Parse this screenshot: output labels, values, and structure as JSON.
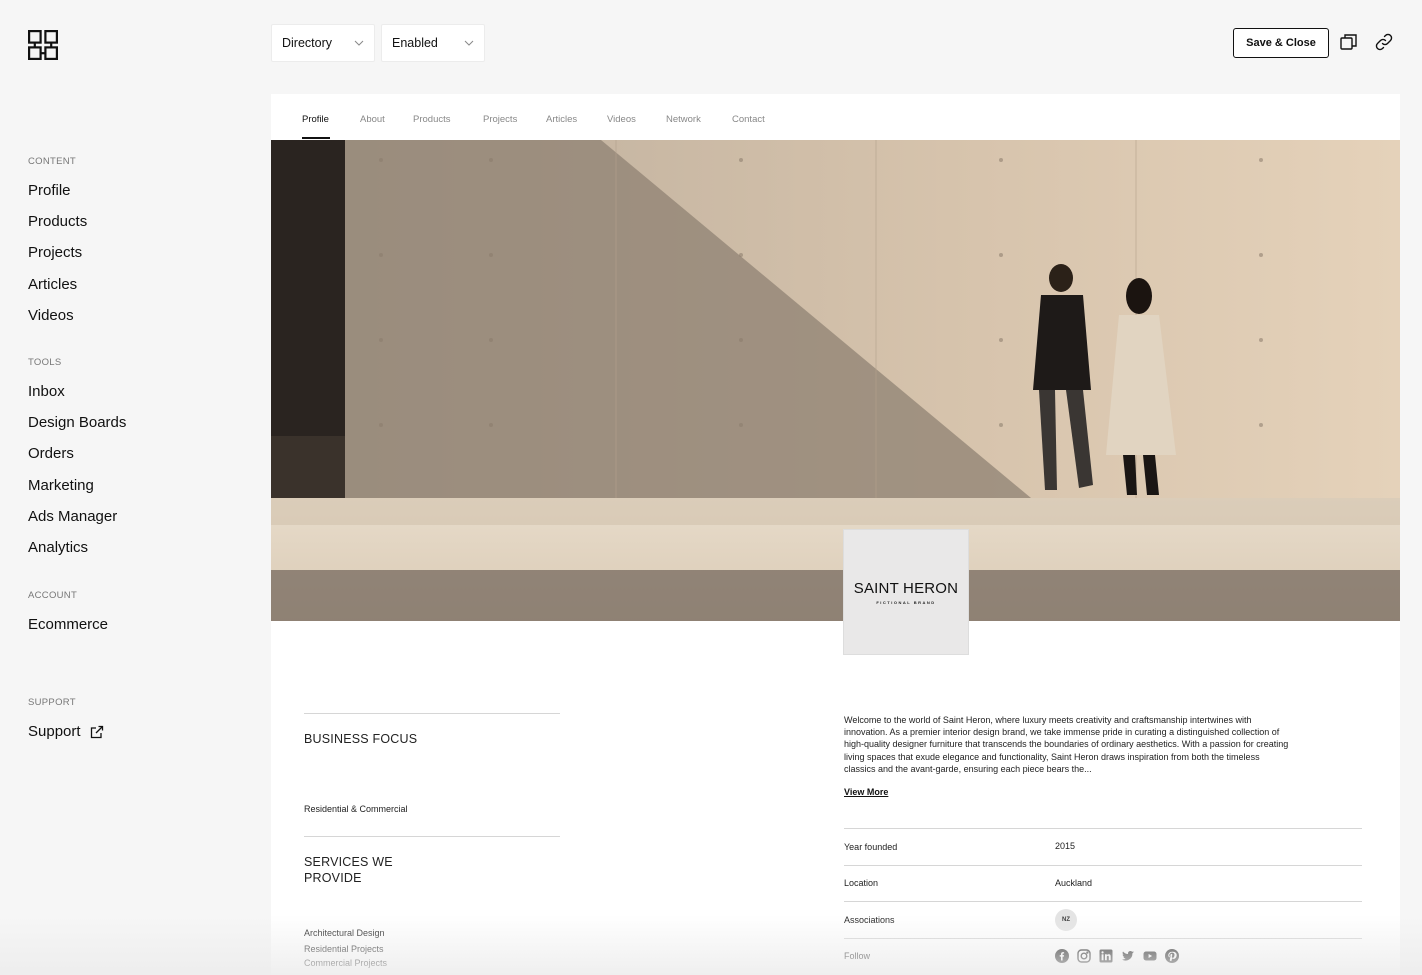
{
  "sidebar": {
    "sections": [
      {
        "title": "CONTENT",
        "items": [
          "Profile",
          "Products",
          "Projects",
          "Articles",
          "Videos"
        ]
      },
      {
        "title": "TOOLS",
        "items": [
          "Inbox",
          "Design Boards",
          "Orders",
          "Marketing",
          "Ads Manager",
          "Analytics"
        ]
      },
      {
        "title": "ACCOUNT",
        "items": [
          "Ecommerce"
        ]
      },
      {
        "title": "SUPPORT",
        "items": [
          "Support"
        ]
      }
    ]
  },
  "topbar": {
    "type_select": "Directory",
    "status_select": "Enabled",
    "save_label": "Save & Close"
  },
  "tabs": [
    "Profile",
    "About",
    "Products",
    "Projects",
    "Articles",
    "Videos",
    "Network",
    "Contact"
  ],
  "brand": {
    "name": "SAINT HERON",
    "tagline": "FICTIONAL BRAND"
  },
  "business_focus": {
    "heading": "BUSINESS FOCUS",
    "value": "Residential & Commercial"
  },
  "services": {
    "heading": "SERVICES WE PROVIDE",
    "items": [
      "Architectural Design",
      "Residential Projects",
      "Commercial Projects"
    ]
  },
  "about": {
    "text": "Welcome to the world of Saint Heron, where luxury meets creativity and craftsmanship intertwines with innovation. As a premier interior design brand, we take immense pride in curating a distinguished collection of high-quality designer furniture that transcends the boundaries of ordinary aesthetics. With a passion for creating living spaces that exude elegance and functionality, Saint Heron draws inspiration from both the timeless classics and the avant-garde, ensuring each piece bears the...",
    "view_more": "View More"
  },
  "info": {
    "year_label": "Year founded",
    "year_value": "2015",
    "location_label": "Location",
    "location_value": "Auckland",
    "associations_label": "Associations",
    "association_badge": "NZ",
    "follow_label": "Follow"
  },
  "icons": {
    "logo": "grid-logo-icon",
    "duplicate": "duplicate-icon",
    "link": "link-icon",
    "external": "external-link-icon",
    "social": [
      "facebook-icon",
      "instagram-icon",
      "linkedin-icon",
      "twitter-icon",
      "youtube-icon",
      "pinterest-icon"
    ]
  }
}
